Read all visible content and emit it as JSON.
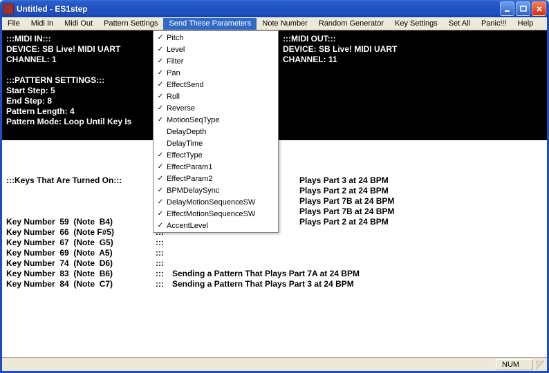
{
  "title": "Untitled - ES1step",
  "menubar": [
    "File",
    "Midi In",
    "Midi Out",
    "Pattern Settings",
    "Send These Parameters",
    "Note Number",
    "Random Generator",
    "Key Settings",
    "Set All",
    "Panic!!!",
    "Help"
  ],
  "menubar_highlighted_index": 4,
  "dropdown": [
    {
      "label": "Pitch",
      "checked": true
    },
    {
      "label": "Level",
      "checked": true
    },
    {
      "label": "Filter",
      "checked": true
    },
    {
      "label": "Pan",
      "checked": true
    },
    {
      "label": "EffectSend",
      "checked": true
    },
    {
      "label": "Roll",
      "checked": true
    },
    {
      "label": "Reverse",
      "checked": true
    },
    {
      "label": "MotionSeqType",
      "checked": true
    },
    {
      "label": "DelayDepth",
      "checked": false
    },
    {
      "label": "DelayTime",
      "checked": false
    },
    {
      "label": "EffectType",
      "checked": true
    },
    {
      "label": "EffectParam1",
      "checked": true
    },
    {
      "label": "EffectParam2",
      "checked": true
    },
    {
      "label": "BPMDelaySync",
      "checked": true
    },
    {
      "label": "DelayMotionSequenceSW",
      "checked": true
    },
    {
      "label": "EffectMotionSequenceSW",
      "checked": true
    },
    {
      "label": "AccentLevel",
      "checked": true
    }
  ],
  "midi_in": {
    "heading": ":::MIDI IN:::",
    "device": "DEVICE: SB Live! MIDI UART",
    "channel": "CHANNEL: 1"
  },
  "midi_out": {
    "heading": ":::MIDI OUT:::",
    "device": "DEVICE: SB Live! MIDI UART",
    "channel": "CHANNEL: 11"
  },
  "pattern_settings": {
    "heading": ":::PATTERN SETTINGS:::",
    "start_step": "Start Step: 5",
    "end_step": "End Step: 8",
    "length": "Pattern Length: 4",
    "mode": "Pattern Mode: Loop Until Key Is"
  },
  "keys_heading": ":::Keys That Are Turned On:::",
  "keys": [
    {
      "left": "Key Number  59  (Note  B4)",
      "mid": ":::",
      "right": ""
    },
    {
      "left": "Key Number  66  (Note F#5)",
      "mid": ":::",
      "right": ""
    },
    {
      "left": "Key Number  67  (Note  G5)",
      "mid": ":::",
      "right": ""
    },
    {
      "left": "Key Number  69  (Note  A5)",
      "mid": ":::",
      "right": ""
    },
    {
      "left": "Key Number  74  (Note  D6)",
      "mid": ":::",
      "right": ""
    },
    {
      "left": "Key Number  83  (Note  B6)",
      "mid": ":::",
      "right": "Sending a Pattern That Plays Part 7A at 24 BPM"
    },
    {
      "left": "Key Number  84  (Note  C7)",
      "mid": ":::",
      "right": "Sending a Pattern That Plays Part 3 at 24 BPM"
    }
  ],
  "right_plays": [
    "Plays Part 3 at 24 BPM",
    "Plays Part 2 at 24 BPM",
    "Plays Part 7B at 24 BPM",
    "Plays Part 7B at 24 BPM",
    "Plays Part 2 at 24 BPM"
  ],
  "status": {
    "num": "NUM"
  }
}
